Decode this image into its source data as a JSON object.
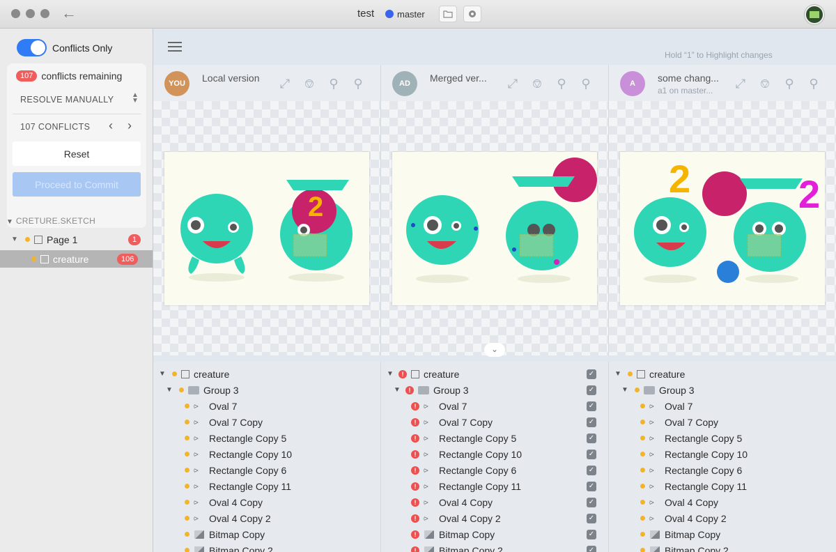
{
  "window": {
    "title": "test",
    "branch": "master"
  },
  "sidebar": {
    "toggle_label": "Conflicts Only",
    "conflicts_remaining_count": "107",
    "conflicts_remaining_label": "conflicts remaining",
    "resolve_mode": "RESOLVE MANUALLY",
    "conflicts_label": "107 CONFLICTS",
    "reset_label": "Reset",
    "proceed_label": "Proceed to Commit",
    "file_name": "CRETURE.SKETCH",
    "pages": [
      {
        "label": "Page 1",
        "count": "1"
      },
      {
        "label": "creature",
        "count": "106"
      }
    ]
  },
  "main": {
    "hint": "Hold “1” to Highlight changes",
    "columns": [
      {
        "avatar": "YOU",
        "avatar_color": "#d2935a",
        "title": "Local version",
        "subtitle": ""
      },
      {
        "avatar": "AD",
        "avatar_color": "#9fb2b8",
        "title": "Merged ver...",
        "subtitle": ""
      },
      {
        "avatar": "A",
        "avatar_color": "#c98fd8",
        "title": "some chang...",
        "subtitle": "a1 on master..."
      }
    ],
    "tools": [
      "fit-icon",
      "lasso-icon",
      "zoom-out-icon",
      "zoom-in-icon"
    ],
    "layers": {
      "root": "creature",
      "group": "Group 3",
      "items": [
        {
          "label": "Oval 7",
          "type": "shape"
        },
        {
          "label": "Oval 7 Copy",
          "type": "shape"
        },
        {
          "label": "Rectangle Copy 5",
          "type": "shape"
        },
        {
          "label": "Rectangle Copy 10",
          "type": "shape"
        },
        {
          "label": "Rectangle Copy 6",
          "type": "shape"
        },
        {
          "label": "Rectangle Copy 11",
          "type": "shape"
        },
        {
          "label": "Oval 4 Copy",
          "type": "shape"
        },
        {
          "label": "Oval 4 Copy 2",
          "type": "shape"
        },
        {
          "label": "Bitmap Copy",
          "type": "bitmap"
        },
        {
          "label": "Bitmap Copy 2",
          "type": "bitmap"
        }
      ]
    }
  },
  "colors": {
    "accent": "#2f7cf6",
    "conflict": "#f05d5d",
    "modified": "#f4b429",
    "creature": "#2fd6b5"
  }
}
